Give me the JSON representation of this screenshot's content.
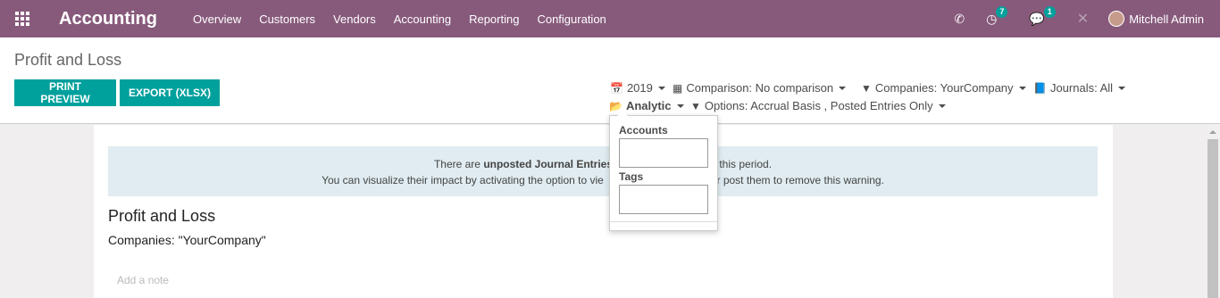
{
  "navbar": {
    "brand": "Accounting",
    "menu": [
      "Overview",
      "Customers",
      "Vendors",
      "Accounting",
      "Reporting",
      "Configuration"
    ],
    "activity_count": "7",
    "message_count": "1",
    "user_name": "Mitchell Admin"
  },
  "control_panel": {
    "breadcrumb": "Profit and Loss",
    "print_label": "PRINT PREVIEW",
    "export_label": "EXPORT (XLSX)",
    "filters": {
      "year": "2019",
      "comparison": "Comparison: No comparison",
      "companies": "Companies: YourCompany",
      "journals": "Journals: All",
      "analytic": "Analytic",
      "options": "Options: Accrual Basis , Posted Entries Only"
    }
  },
  "dropdown": {
    "accounts_label": "Accounts",
    "tags_label": "Tags"
  },
  "alert": {
    "line1_prefix": "There are ",
    "line1_bold": "unposted Journal Entries",
    "line1_suffix": " this period.",
    "line2_prefix": "You can visualize their impact by activating the option to vie",
    "line2_suffix": "or post them to remove this warning."
  },
  "report": {
    "title": "Profit and Loss",
    "companies": "Companies: \"YourCompany\"",
    "note_placeholder": "Add a note"
  },
  "colors": {
    "navbar": "#875a7b",
    "primary": "#00a09d",
    "alert_bg": "#e0ecf1"
  }
}
